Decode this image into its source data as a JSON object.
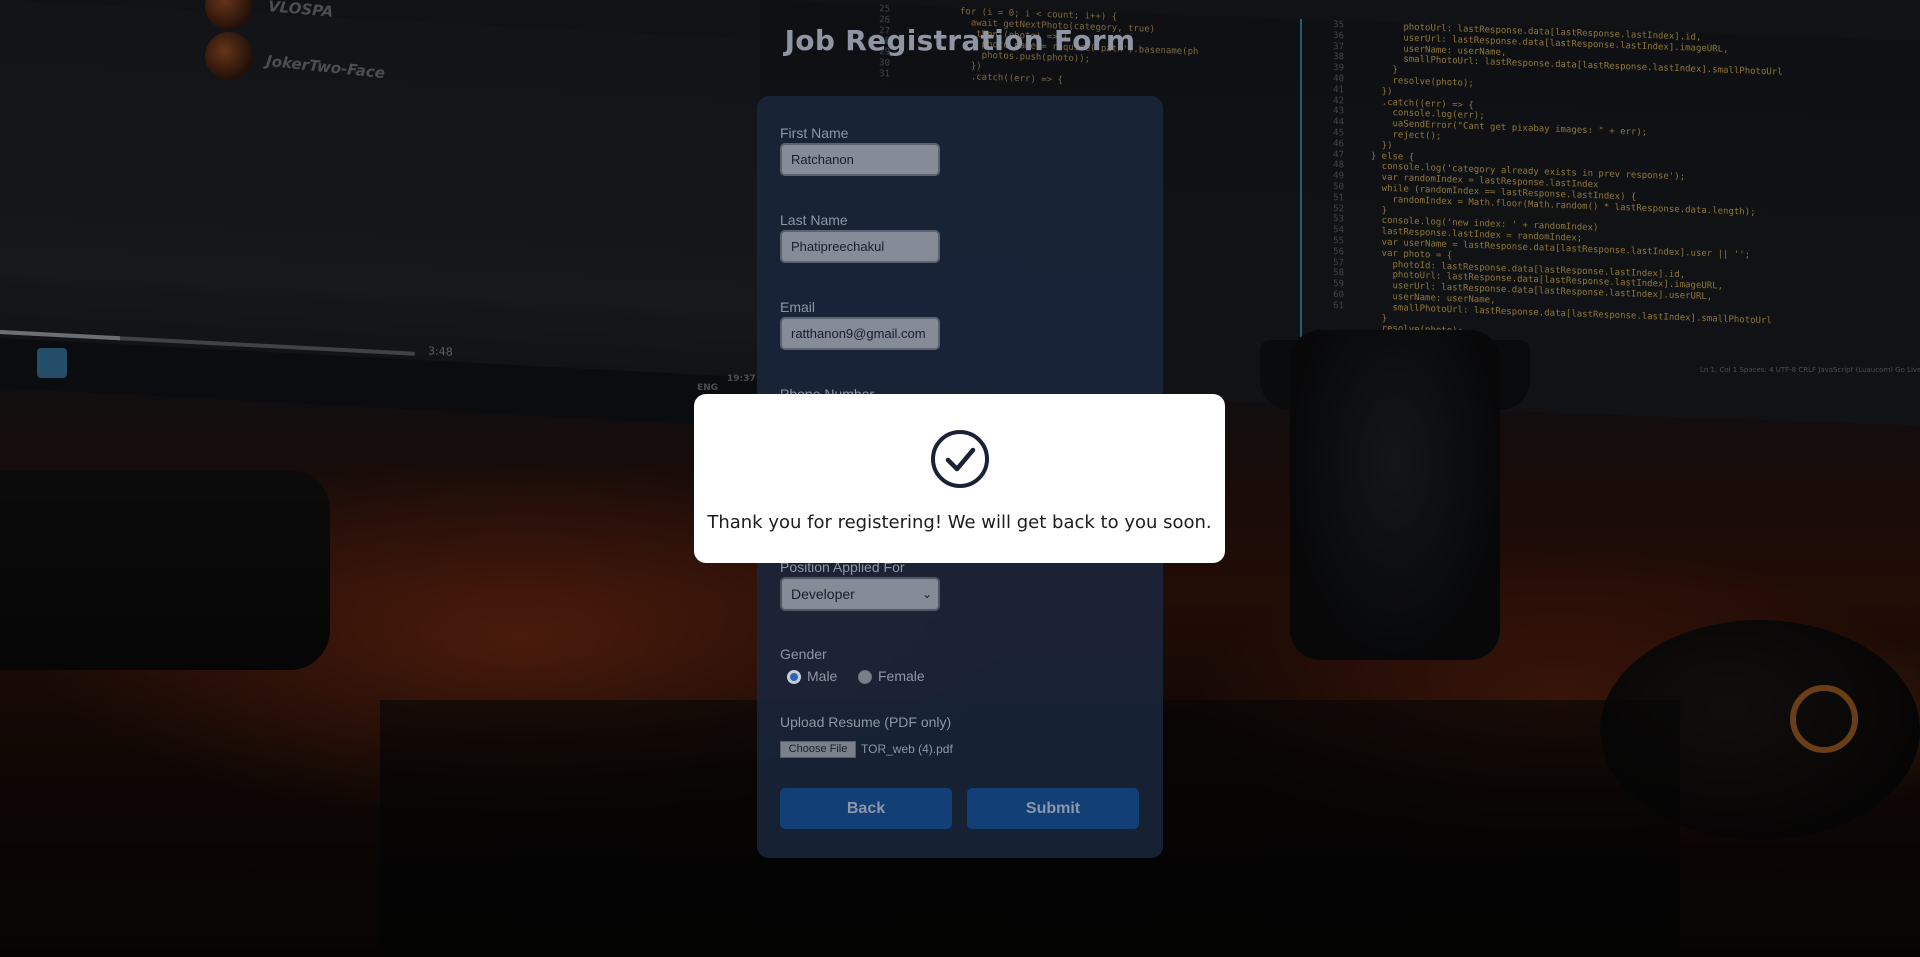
{
  "page": {
    "title": "Job Registration Form"
  },
  "background": {
    "channel_1": "VLOSPA",
    "channel_2": "JokerTwo-Face",
    "video_time": "3:48",
    "tray_lang": "ENG",
    "tray_time": "19:37",
    "code_status": "Ln 1, Col 1   Spaces: 4   UTF-8   CRLF   JavaScript (Luaucom)   Go Live",
    "line_numbers_left": "25\n26\n27\n28\n29\n30\n31",
    "code_left": "for (i = 0; i < count; i++) {\n  await getNextPhoto(category, true)\n  .then((photo) => {\n    photo.name = require('path').basename(ph\n    photos.push(photo));\n  })\n  .catch((err) => {",
    "line_numbers_right": "35\n36\n37\n38\n39\n40\n41\n42\n43\n44\n45\n46\n47\n48\n49\n50\n51\n52\n53\n54\n55\n56\n57\n58\n59\n60\n61",
    "code_right": "        photoUrl: lastResponse.data[lastResponse.lastIndex].id,\n        userUrl: lastResponse.data[lastResponse.lastIndex].imageURL,\n        userName: userName,\n        smallPhotoUrl: lastResponse.data[lastResponse.lastIndex].smallPhotoUrl\n      }\n      resolve(photo);\n    })\n    .catch((err) => {\n      console.log(err);\n      uaSendError(\"Cant get pixabay images: \" + err);\n      reject();\n    })\n  } else {\n    console.log('category already exists in prev response');\n    var randomIndex = lastResponse.lastIndex\n    while (randomIndex == lastResponse.lastIndex) {\n      randomIndex = Math.floor(Math.random() * lastResponse.data.length);\n    }\n    console.log('new index: ' + randomIndex)\n    lastResponse.lastIndex = randomIndex;\n    var userName = lastResponse.data[lastResponse.lastIndex].user || '';\n    var photo = {\n      photoId: lastResponse.data[lastResponse.lastIndex].id,\n      photoUrl: lastResponse.data[lastResponse.lastIndex].imageURL,\n      userUrl: lastResponse.data[lastResponse.lastIndex].userURL,\n      userName: userName,\n      smallPhotoUrl: lastResponse.data[lastResponse.lastIndex].smallPhotoUrl\n    }\n    resolve(photo);"
  },
  "form": {
    "first_name_label": "First Name",
    "first_name_value": "Ratchanon",
    "last_name_label": "Last Name",
    "last_name_value": "Phatipreechakul",
    "email_label": "Email",
    "email_value": "ratthanon9@gmail.com",
    "phone_label": "Phone Number",
    "position_label": "Position Applied For",
    "position_value": "Developer",
    "gender_label": "Gender",
    "gender_male": "Male",
    "gender_female": "Female",
    "gender_selected": "Male",
    "resume_label": "Upload Resume (PDF only)",
    "choose_file_label": "Choose File",
    "file_name": "TOR_web (4).pdf",
    "back_label": "Back",
    "submit_label": "Submit"
  },
  "modal": {
    "icon": "check-circle-icon",
    "message": "Thank you for registering! We will get back to you soon."
  },
  "colors": {
    "button_bg": "#123f75",
    "modal_bg": "#ffffff",
    "check_icon": "#1a2236"
  }
}
